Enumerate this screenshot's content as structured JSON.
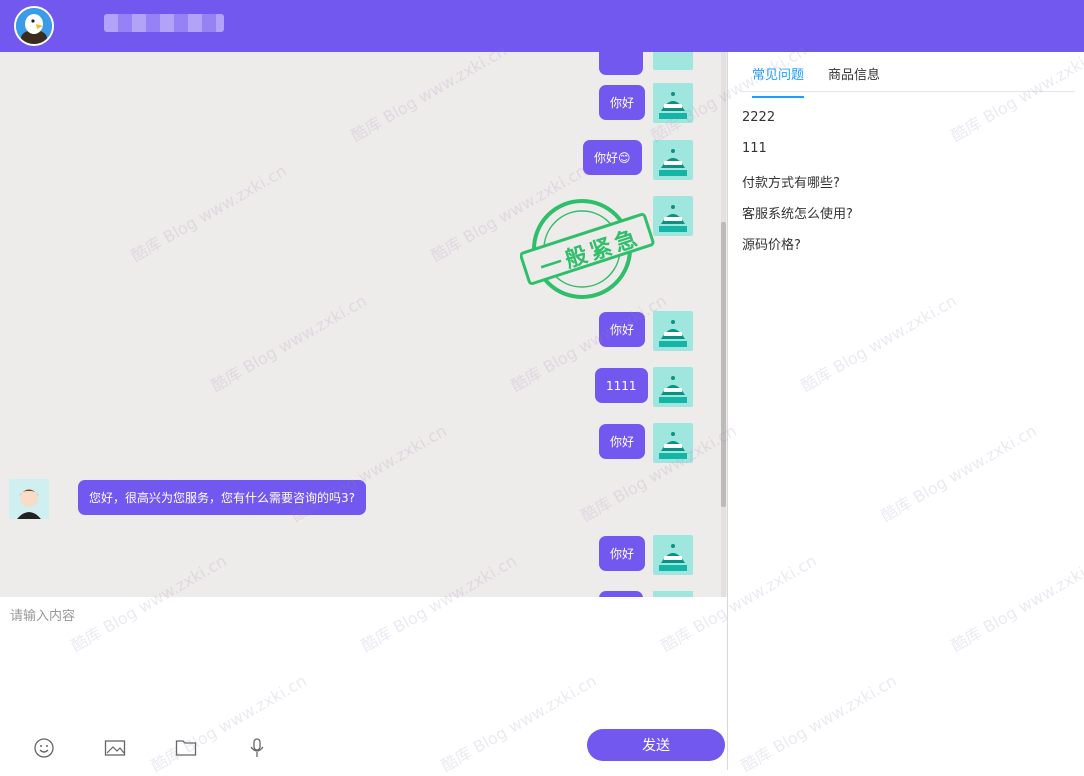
{
  "header": {
    "avatar_icon": "eagle-avatar-icon",
    "accent": "#7358f0"
  },
  "chat": {
    "messages": [
      {
        "side": "right",
        "text": ""
      },
      {
        "side": "right",
        "text": "你好"
      },
      {
        "side": "right",
        "text": "你好😊"
      },
      {
        "side": "right",
        "text": "你好"
      },
      {
        "side": "right",
        "text": "1111"
      },
      {
        "side": "right",
        "text": "你好"
      },
      {
        "side": "left",
        "text": "您好，很高兴为您服务，您有什么需要咨询的吗3?"
      },
      {
        "side": "right",
        "text": "你好"
      }
    ],
    "stamp": "一般紧急"
  },
  "composer": {
    "placeholder": "请输入内容",
    "send_label": "发送",
    "tools": [
      "emoji-icon",
      "image-icon",
      "folder-icon",
      "microphone-icon"
    ]
  },
  "sidebar": {
    "tabs": [
      {
        "label": "常见问题",
        "active": true
      },
      {
        "label": "商品信息",
        "active": false
      }
    ],
    "faq": [
      "2222",
      "111",
      "付款方式有哪些?",
      "客服系统怎么使用?",
      "源码价格?"
    ]
  },
  "watermark": "酷库 Blog www.zxki.cn"
}
